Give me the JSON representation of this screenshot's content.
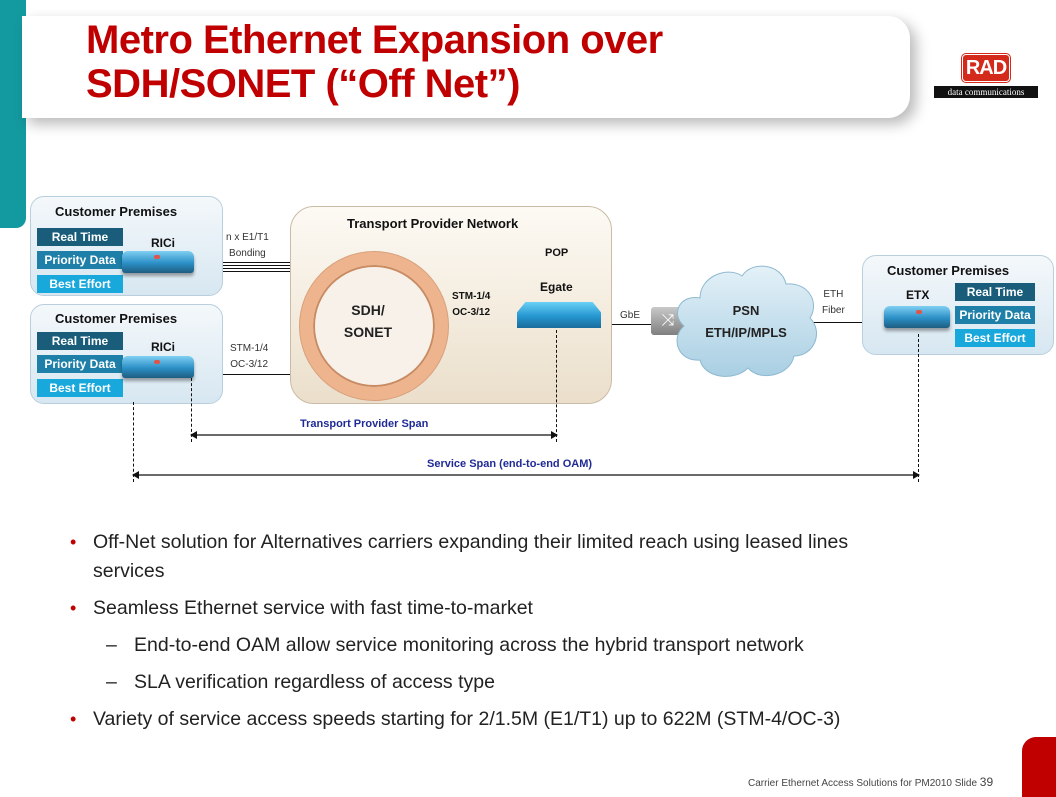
{
  "slide": {
    "title_line1": "Metro Ethernet Expansion over",
    "title_line2": "SDH/SONET (“Off Net”)",
    "logo": {
      "brand": "RAD",
      "tagline": "data communications",
      "brand_color": "#d42a1b"
    },
    "accent_color": "#c00000",
    "teal_color": "#139aa0"
  },
  "diagram": {
    "customer_premises_top": {
      "title": "Customer Premises",
      "device": "RICi",
      "tags": [
        "Real Time",
        "Priority Data",
        "Best Effort"
      ],
      "link_label_1": "n x E1/T1",
      "link_label_2": "Bonding"
    },
    "customer_premises_bottom": {
      "title": "Customer Premises",
      "device": "RICi",
      "tags": [
        "Real Time",
        "Priority Data",
        "Best Effort"
      ],
      "link_label_1": "STM-1/4",
      "link_label_2": "OC-3/12"
    },
    "transport_network": {
      "title": "Transport  Provider Network",
      "ring_line1": "SDH/",
      "ring_line2": "SONET",
      "pop_label": "POP",
      "egate_label": "Egate",
      "link_label_1": "STM-1/4",
      "link_label_2": "OC-3/12"
    },
    "gbe_label": "GbE",
    "psn": {
      "line1": "PSN",
      "line2": "ETH/IP/MPLS"
    },
    "eth_fiber": {
      "line1": "ETH",
      "line2": "Fiber"
    },
    "customer_premises_right": {
      "title": "Customer Premises",
      "device": "ETX",
      "tags": [
        "Real Time",
        "Priority Data",
        "Best Effort"
      ]
    },
    "transport_span_label": "Transport Provider Span",
    "service_span_label": "Service Span (end-to-end OAM)"
  },
  "bullets": {
    "b1": "Off-Net solution for Alternatives carriers expanding their  limited reach using leased lines services",
    "b2": "Seamless Ethernet service with fast time-to-market",
    "b2_sub1": "End-to-end OAM allow service monitoring  across the hybrid transport network",
    "b2_sub2": "SLA verification regardless of  access type",
    "b3": "Variety of service access speeds starting for 2/1.5M (E1/T1) up to 622M (STM-4/OC-3)"
  },
  "footer": {
    "text": "Carrier Ethernet Access Solutions for PM2010  Slide ",
    "slide_number": "39"
  }
}
